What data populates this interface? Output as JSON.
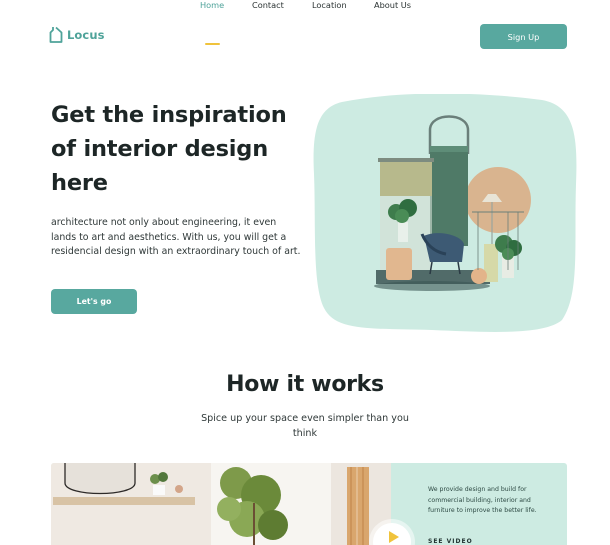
{
  "brand": {
    "name": "Locus",
    "color": "#4fa39a"
  },
  "nav": {
    "links": [
      {
        "label": "Home",
        "active": true
      },
      {
        "label": "Contact",
        "active": false
      },
      {
        "label": "Location",
        "active": false
      },
      {
        "label": "About Us",
        "active": false
      }
    ],
    "signup_label": "Sign Up"
  },
  "hero": {
    "title": "Get the inspiration of interior design here",
    "description": "architecture not only about engineering, it even lands to art and aesthetics. With us, you will get a residencial design with an extraordinary touch of art.",
    "cta_label": "Let's go",
    "image_icon": "interior-design-illustration"
  },
  "how": {
    "title": "How it works",
    "subtitle": "Spice up your space even simpler than you think",
    "video_card": {
      "text": "We provide design and build for commercial building, interior and furniture to improve the better life.",
      "see_video_label": "SEE VIDEO",
      "play_icon": "play-icon"
    }
  },
  "colors": {
    "accent": "#58a89f",
    "mint": "#cdebe2",
    "underline": "#f0c33c",
    "play": "#f0c33c"
  }
}
